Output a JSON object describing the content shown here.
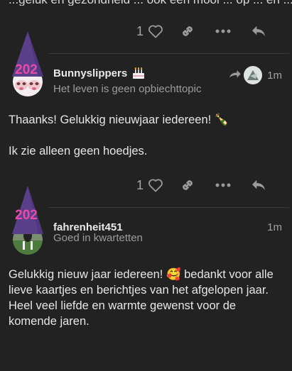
{
  "previous_post": {
    "cut_text": "...geluk en gezondheid ... ook een mooi ... op ... en ..."
  },
  "actions": {
    "like_count_1": "1",
    "like_count_2": "1"
  },
  "posts": [
    {
      "username": "Bunnyslippers",
      "user_title": "Het leven is geen opbiechttopic",
      "time": "1m",
      "badge_icon": "birthday-cake-icon",
      "paragraphs": [
        "Thaanks! Gelukkig nieuwjaar iedereen! 🍾",
        "Ik zie alleen geen hoedjes."
      ],
      "hat_text": "202"
    },
    {
      "username": "fahrenheit451",
      "user_title": "Goed in kwartetten",
      "time": "1m",
      "paragraphs": [
        "Gelukkig nieuw jaar iedereen! 🥰 bedankt voor alle lieve kaartjes en berichtjes van het afgelopen jaar. Heel veel liefde en warmte gewenst voor de komende jaren."
      ],
      "hat_text": "202"
    }
  ],
  "colors": {
    "background": "#222222",
    "hat": "#5a3f8a",
    "hat_text": "#e94aa8",
    "icon": "#9a9a9a"
  }
}
